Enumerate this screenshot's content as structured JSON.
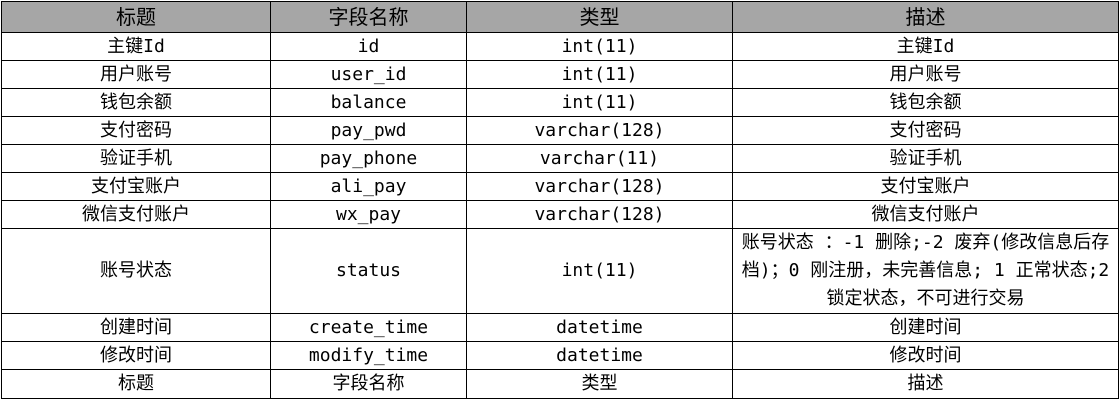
{
  "table": {
    "headers": [
      "标题",
      "字段名称",
      "类型",
      "描述"
    ],
    "rows": [
      [
        "主键Id",
        "id",
        "int(11)",
        "主键Id"
      ],
      [
        "用户账号",
        "user_id",
        "int(11)",
        "用户账号"
      ],
      [
        "钱包余额",
        "balance",
        "int(11)",
        "钱包余额"
      ],
      [
        "支付密码",
        "pay_pwd",
        "varchar(128)",
        "支付密码"
      ],
      [
        "验证手机",
        "pay_phone",
        "varchar(11)",
        "验证手机"
      ],
      [
        "支付宝账户",
        "ali_pay",
        "varchar(128)",
        "支付宝账户"
      ],
      [
        "微信支付账户",
        "wx_pay",
        "varchar(128)",
        "微信支付账户"
      ],
      [
        "账号状态",
        "status",
        "int(11)",
        "账号状态 ：-1 删除;-2 废弃(修改信息后存档)；0 刚注册，未完善信息; 1 正常状态;2 锁定状态，不可进行交易"
      ],
      [
        "创建时间",
        "create_time",
        "datetime",
        "创建时间"
      ],
      [
        "修改时间",
        "modify_time",
        "datetime",
        "修改时间"
      ]
    ],
    "footer": [
      "标题",
      "字段名称",
      "类型",
      "描述"
    ]
  },
  "colors": {
    "header_bg": "#a6a6a6",
    "border": "#000000"
  }
}
